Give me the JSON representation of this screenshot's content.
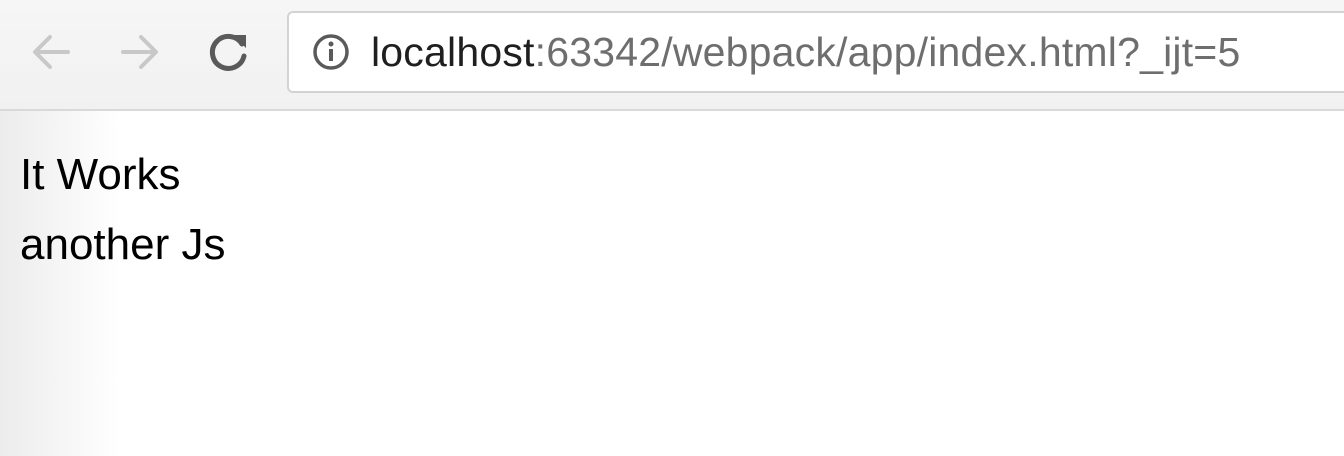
{
  "toolbar": {
    "back_icon": "arrow-left-icon",
    "forward_icon": "arrow-right-icon",
    "reload_icon": "reload-icon",
    "info_icon": "info-circle-icon"
  },
  "address_bar": {
    "host": "localhost",
    "rest": ":63342/webpack/app/index.html?_ijt=5"
  },
  "page": {
    "lines": [
      "It Works",
      "another Js"
    ]
  },
  "colors": {
    "toolbar_bg": "#f3f3f3",
    "disabled_icon": "#c8c8c8",
    "active_icon": "#5a5a5a",
    "url_host": "#1f1f1f",
    "url_rest": "#6e6e6e",
    "text": "#000000"
  }
}
